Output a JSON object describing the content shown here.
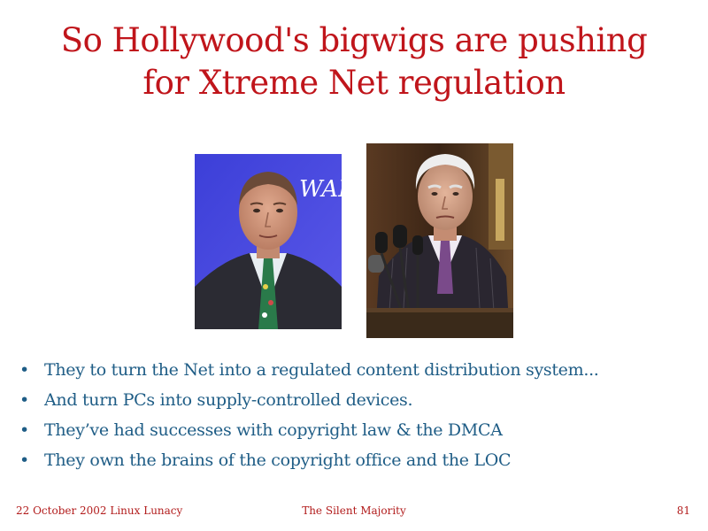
{
  "slide": {
    "title_line1": "So Hollywood's bigwigs are pushing",
    "title_line2": "for Xtreme Net regulation",
    "bullets": [
      "They to turn the Net into a regulated content distribution system...",
      "And turn PCs into supply-controlled devices.",
      "They’ve had successes with copyright law & the DMCA",
      "They own the brains of the copyright office and the LOC"
    ],
    "bullet_symbol": "•",
    "photo_left_sign_text": "WALT",
    "colors": {
      "title": "#c0151b",
      "bullets": "#1f5d86",
      "footer": "#b21c1c"
    }
  },
  "footer": {
    "left": "22 October 2002 Linux Lunacy",
    "center": "The Silent Majority",
    "page_number": "81"
  }
}
